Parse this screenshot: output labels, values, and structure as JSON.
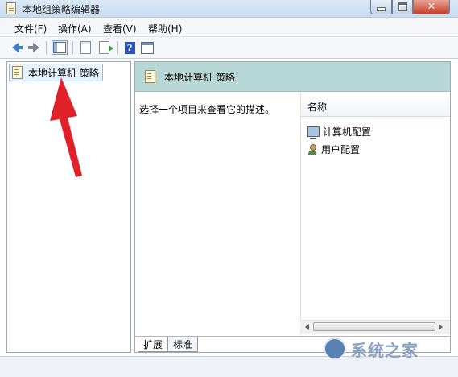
{
  "window": {
    "title": "本地组策略编辑器"
  },
  "menu": [
    {
      "label": "文件(F)"
    },
    {
      "label": "操作(A)"
    },
    {
      "label": "查看(V)"
    },
    {
      "label": "帮助(H)"
    }
  ],
  "toolbar": {
    "icons": [
      "back-arrow-icon",
      "forward-arrow-icon",
      "show-tree-icon",
      "page-icon",
      "export-list-icon",
      "help-icon",
      "properties-icon"
    ]
  },
  "tree": {
    "root_label": "本地计算机 策略"
  },
  "details": {
    "header_title": "本地计算机 策略",
    "description": "选择一个项目来查看它的描述。",
    "column_name": "名称",
    "items": [
      {
        "label": "计算机配置",
        "icon": "computer-icon"
      },
      {
        "label": "用户配置",
        "icon": "user-icon"
      }
    ]
  },
  "tabs": [
    {
      "label": "扩展"
    },
    {
      "label": "标准"
    }
  ],
  "annotation": {
    "arrow_color": "#e0212a"
  },
  "watermark": {
    "text": "系统之家"
  },
  "colors": {
    "header_bg": "#b6d7d6",
    "titlebar": "#c9dcf0",
    "close_button": "#c4402a"
  }
}
